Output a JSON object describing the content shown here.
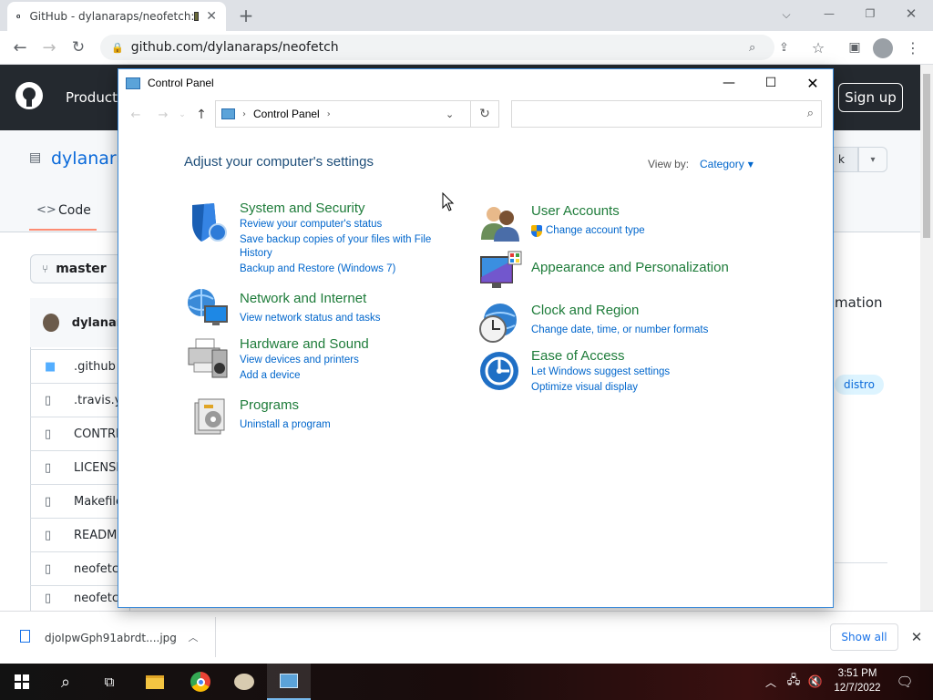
{
  "browser": {
    "tab_title": "GitHub - dylanaraps/neofetch:",
    "url": "github.com/dylanaraps/neofetch",
    "new_tab": "+"
  },
  "github": {
    "header_product": "Product",
    "sign_up": "Sign up",
    "repo_name": "dylanara",
    "tab_code": "Code",
    "fork_fragment": "k",
    "branch": "master",
    "commit_user": "dylanara",
    "files": [
      ".github",
      ".travis.yr",
      "CONTRI",
      "LICENSE",
      "Makefile",
      "READM",
      "neofetc",
      "neofetc"
    ],
    "about_fragment": "mation",
    "topic": "distro"
  },
  "download": {
    "filename": "djoIpwGph91abrdt....jpg",
    "show_all": "Show all"
  },
  "taskbar": {
    "time": "3:51 PM",
    "date": "12/7/2022"
  },
  "control_panel": {
    "title": "Control Panel",
    "breadcrumb": "Control Panel",
    "heading": "Adjust your computer's settings",
    "view_by_label": "View by:",
    "view_by_value": "Category",
    "categories_left": [
      {
        "title": "System and Security",
        "links": [
          "Review your computer's status",
          "Save backup copies of your files with File",
          "History",
          "Backup and Restore (Windows 7)"
        ]
      },
      {
        "title": "Network and Internet",
        "links": [
          "View network status and tasks"
        ]
      },
      {
        "title": "Hardware and Sound",
        "links": [
          "View devices and printers",
          "Add a device"
        ]
      },
      {
        "title": "Programs",
        "links": [
          "Uninstall a program"
        ]
      }
    ],
    "categories_right": [
      {
        "title": "User Accounts",
        "links": [
          "Change account type"
        ]
      },
      {
        "title": "Appearance and Personalization",
        "links": []
      },
      {
        "title": "Clock and Region",
        "links": [
          "Change date, time, or number formats"
        ]
      },
      {
        "title": "Ease of Access",
        "links": [
          "Let Windows suggest settings",
          "Optimize visual display"
        ]
      }
    ]
  }
}
